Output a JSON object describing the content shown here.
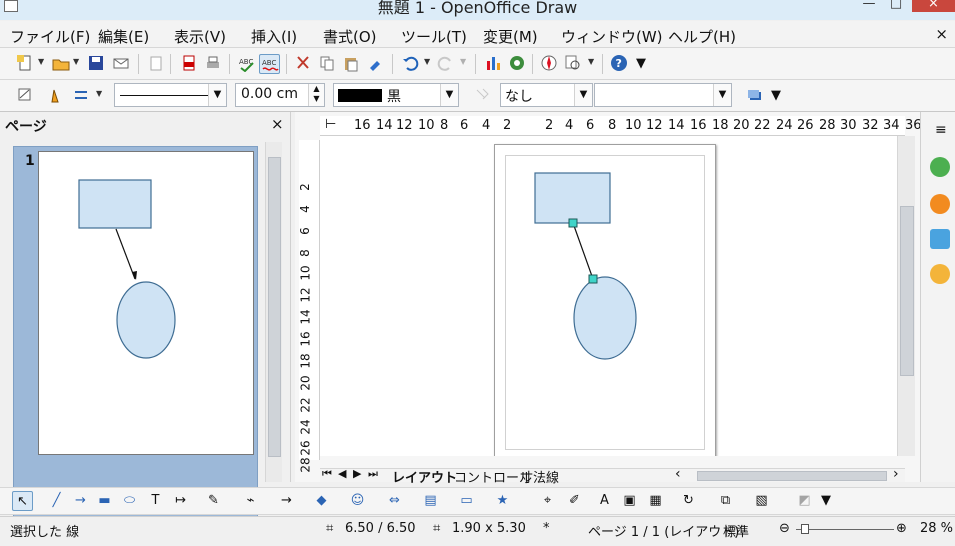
{
  "window": {
    "title": "無題 1 - OpenOffice Draw",
    "close": "×"
  },
  "menu": [
    "ファイル(F)",
    "編集(E)",
    "表示(V)",
    "挿入(I)",
    "書式(O)",
    "ツール(T)",
    "変更(M)",
    "ウィンドウ(W)",
    "ヘルプ(H)"
  ],
  "toolbar2": {
    "line_width": "0.00 cm",
    "color_name": "黒",
    "fill": "なし",
    "fill_value": ""
  },
  "left_panel": {
    "title": "ページ",
    "close": "×",
    "page_number": "1"
  },
  "ruler": {
    "top": [
      "16",
      "14",
      "12",
      "10",
      "8",
      "6",
      "4",
      "2",
      "2",
      "4",
      "6",
      "8",
      "10",
      "12",
      "14",
      "16",
      "18",
      "20",
      "22",
      "24",
      "26",
      "28",
      "30",
      "32",
      "34",
      "36"
    ],
    "left": [
      "2",
      "4",
      "6",
      "8",
      "10",
      "12",
      "14",
      "16",
      "18",
      "20",
      "22",
      "24",
      "26",
      "28"
    ]
  },
  "tabs": [
    "レイアウト",
    "コントロール",
    "寸法線"
  ],
  "status": {
    "selection": "選択した 線",
    "position": "6.50 / 6.50",
    "size": "1.90 x 5.30",
    "modified": "*",
    "page": "ページ 1 / 1 (レイアウト)",
    "style": "標準",
    "zoom": "28 %"
  },
  "colors": {
    "shape_fill": "#cfe3f4",
    "shape_stroke": "#3f6d93",
    "connector": "#111111",
    "handle": "#3fd4c8"
  },
  "icons": [
    "new-document-icon",
    "open-icon",
    "save-icon",
    "email-icon",
    "edit-file-icon",
    "export-pdf-icon",
    "print-icon",
    "spellcheck-icon",
    "autospellcheck-icon",
    "cut-icon",
    "copy-icon",
    "paste-icon",
    "clone-format-icon",
    "undo-icon",
    "redo-icon",
    "chart-icon",
    "gallery-icon",
    "navigator-icon",
    "zoom-icon",
    "help-icon"
  ]
}
